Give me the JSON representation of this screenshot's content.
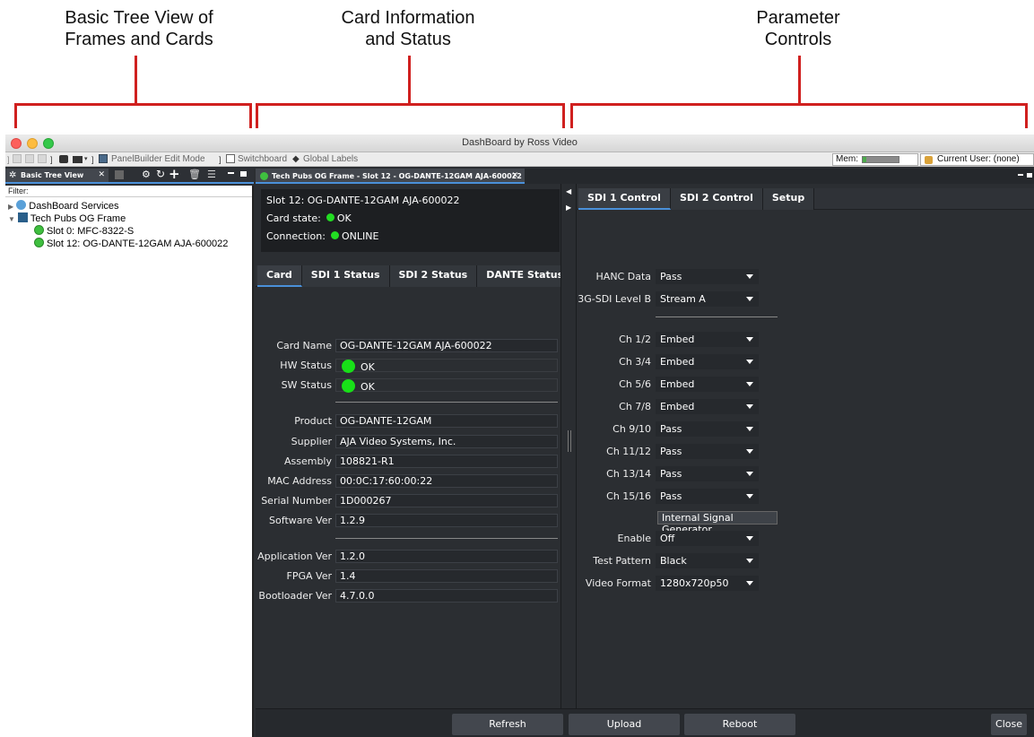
{
  "annotations": {
    "left": [
      "Basic Tree View of",
      "Frames and Cards"
    ],
    "center": [
      "Card Information",
      "and Status"
    ],
    "right": [
      "Parameter",
      "Controls"
    ]
  },
  "window": {
    "title": "DashBoard by Ross Video"
  },
  "toolbar": {
    "panelbuilder": "PanelBuilder Edit Mode",
    "switchboard": "Switchboard",
    "global_labels": "Global Labels",
    "mem_label": "Mem:",
    "mem_usage": 0.1,
    "current_user": "Current User: (none)"
  },
  "tree": {
    "tab_label": "Basic Tree View",
    "filter_label": "Filter:",
    "items": [
      {
        "label": "DashBoard Services"
      },
      {
        "label": "Tech Pubs OG Frame"
      },
      {
        "label": "Slot 0: MFC-8322-S"
      },
      {
        "label": "Slot 12: OG-DANTE-12GAM AJA-600022"
      }
    ]
  },
  "doc_tab": {
    "label": "Tech Pubs OG Frame - Slot 12 - OG-DANTE-12GAM AJA-600022"
  },
  "card_info": {
    "title": "Slot 12: OG-DANTE-12GAM AJA-600022",
    "state_label": "Card state:",
    "state_value": "OK",
    "conn_label": "Connection:",
    "conn_value": "ONLINE"
  },
  "status_tabs": [
    "Card",
    "SDI 1 Status",
    "SDI 2 Status",
    "DANTE Status"
  ],
  "card_fields": {
    "card_name": {
      "label": "Card Name",
      "value": "OG-DANTE-12GAM AJA-600022"
    },
    "hw_status": {
      "label": "HW Status",
      "value": "OK"
    },
    "sw_status": {
      "label": "SW Status",
      "value": "OK"
    },
    "product": {
      "label": "Product",
      "value": "OG-DANTE-12GAM"
    },
    "supplier": {
      "label": "Supplier",
      "value": "AJA Video Systems, Inc."
    },
    "assembly": {
      "label": "Assembly",
      "value": "108821-R1"
    },
    "mac": {
      "label": "MAC Address",
      "value": "00:0C:17:60:00:22"
    },
    "serial": {
      "label": "Serial Number",
      "value": "1D000267"
    },
    "software": {
      "label": "Software Ver",
      "value": "1.2.9"
    },
    "application": {
      "label": "Application Ver",
      "value": "1.2.0"
    },
    "fpga": {
      "label": "FPGA Ver",
      "value": "1.4"
    },
    "bootloader": {
      "label": "Bootloader Ver",
      "value": "4.7.0.0"
    }
  },
  "control_tabs": [
    "SDI 1 Control",
    "SDI 2 Control",
    "Setup"
  ],
  "controls": {
    "hanc": {
      "label": "HANC Data",
      "value": "Pass"
    },
    "level_b": {
      "label": "3G-SDI Level B",
      "value": "Stream A"
    },
    "ch12": {
      "label": "Ch 1/2",
      "value": "Embed"
    },
    "ch34": {
      "label": "Ch 3/4",
      "value": "Embed"
    },
    "ch56": {
      "label": "Ch 5/6",
      "value": "Embed"
    },
    "ch78": {
      "label": "Ch 7/8",
      "value": "Embed"
    },
    "ch910": {
      "label": "Ch 9/10",
      "value": "Pass"
    },
    "ch1112": {
      "label": "Ch 11/12",
      "value": "Pass"
    },
    "ch1314": {
      "label": "Ch 13/14",
      "value": "Pass"
    },
    "ch1516": {
      "label": "Ch 15/16",
      "value": "Pass"
    },
    "isg_header": "Internal Signal Generator",
    "enable": {
      "label": "Enable",
      "value": "Off"
    },
    "pattern": {
      "label": "Test Pattern",
      "value": "Black"
    },
    "format": {
      "label": "Video Format",
      "value": "1280x720p50"
    }
  },
  "buttons": {
    "refresh": "Refresh",
    "upload": "Upload",
    "reboot": "Reboot",
    "close": "Close"
  },
  "colors": {
    "accent": "#4a90d9",
    "ok_green": "#18e018",
    "annotation_red": "#d0201f"
  }
}
